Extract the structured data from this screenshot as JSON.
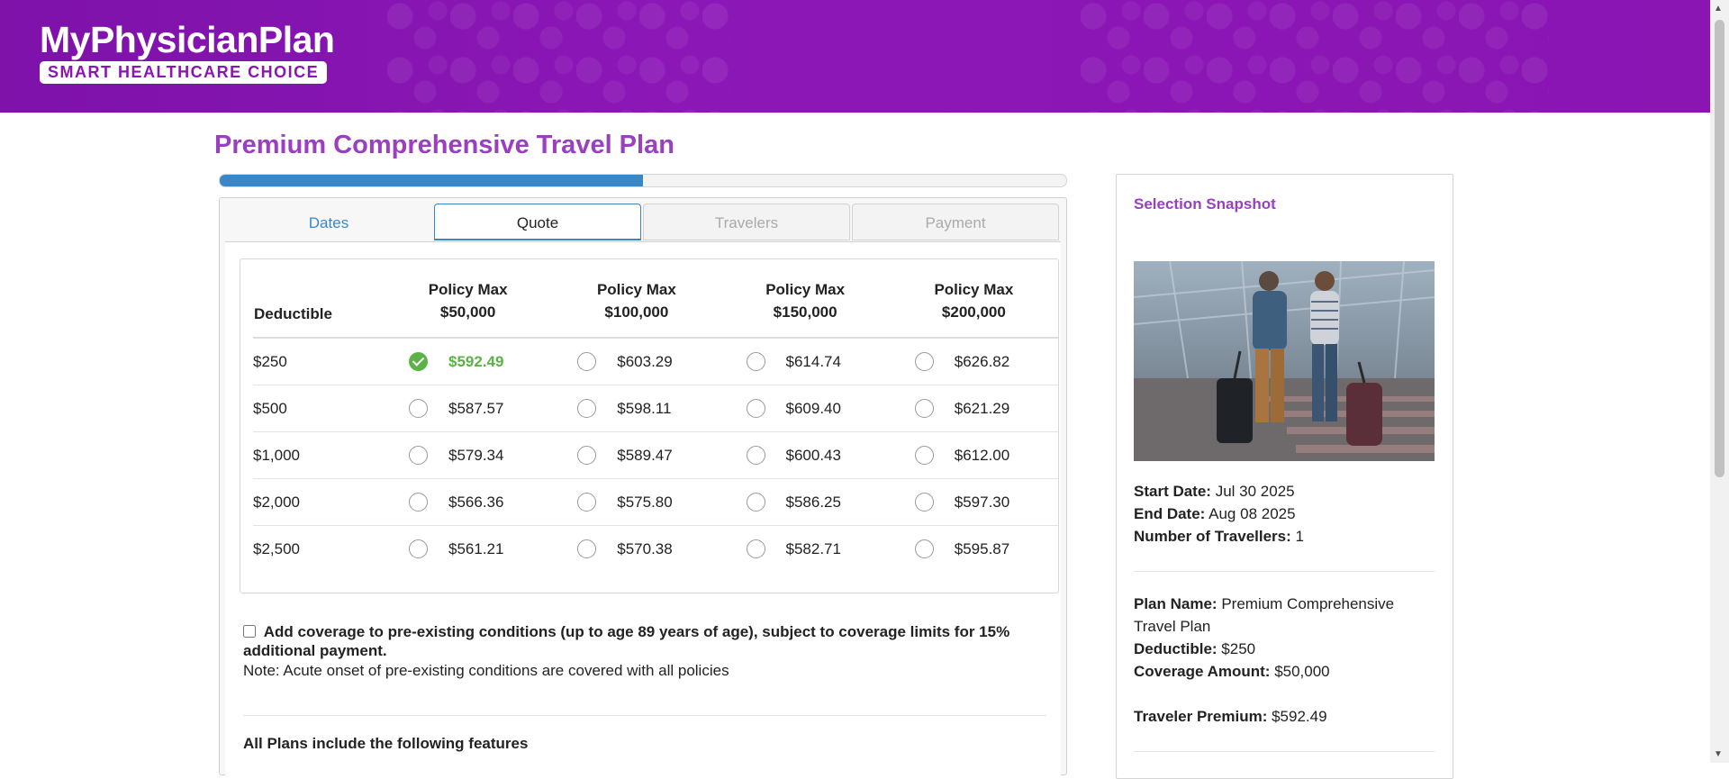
{
  "brand": {
    "name": "MyPhysicianPlan",
    "tagline": "SMART HEALTHCARE CHOICE"
  },
  "page": {
    "title": "Premium Comprehensive Travel Plan",
    "progress_fraction": 0.5
  },
  "tabs": [
    {
      "label": "Dates",
      "state": "done"
    },
    {
      "label": "Quote",
      "state": "active"
    },
    {
      "label": "Travelers",
      "state": "disabled"
    },
    {
      "label": "Payment",
      "state": "disabled"
    }
  ],
  "quote_table": {
    "deductible_header": "Deductible",
    "policy_headers": [
      {
        "line1": "Policy Max",
        "line2": "$50,000"
      },
      {
        "line1": "Policy Max",
        "line2": "$100,000"
      },
      {
        "line1": "Policy Max",
        "line2": "$150,000"
      },
      {
        "line1": "Policy Max",
        "line2": "$200,000"
      }
    ],
    "rows": [
      {
        "deductible": "$250",
        "prices": [
          "$592.49",
          "$603.29",
          "$614.74",
          "$626.82"
        ]
      },
      {
        "deductible": "$500",
        "prices": [
          "$587.57",
          "$598.11",
          "$609.40",
          "$621.29"
        ]
      },
      {
        "deductible": "$1,000",
        "prices": [
          "$579.34",
          "$589.47",
          "$600.43",
          "$612.00"
        ]
      },
      {
        "deductible": "$2,000",
        "prices": [
          "$566.36",
          "$575.80",
          "$586.25",
          "$597.30"
        ]
      },
      {
        "deductible": "$2,500",
        "prices": [
          "$561.21",
          "$570.38",
          "$582.71",
          "$595.87"
        ]
      }
    ],
    "selected": {
      "row": 0,
      "col": 0
    }
  },
  "preexisting": {
    "checked": false,
    "label": "Add coverage to pre-existing conditions (up to age 89 years of age), subject to coverage limits for 15% additional payment.",
    "note": "Note: Acute onset of pre-existing conditions are covered with all policies"
  },
  "features_heading": "All Plans include the following features",
  "snapshot": {
    "title": "Selection Snapshot",
    "start_date_label": "Start Date:",
    "start_date": "Jul 30 2025",
    "end_date_label": "End Date:",
    "end_date": "Aug 08 2025",
    "travellers_label": "Number of Travellers:",
    "travellers": "1",
    "plan_name_label": "Plan Name:",
    "plan_name": "Premium Comprehensive Travel Plan",
    "deductible_label": "Deductible:",
    "deductible": "$250",
    "coverage_label": "Coverage Amount:",
    "coverage": "$50,000",
    "premium_label": "Traveler Premium:",
    "premium": "$592.49"
  },
  "colors": {
    "header_purple": "#8a15b3",
    "title_purple": "#9a3fc0",
    "progress_blue": "#3a87c8",
    "selected_green": "#5cb247"
  }
}
